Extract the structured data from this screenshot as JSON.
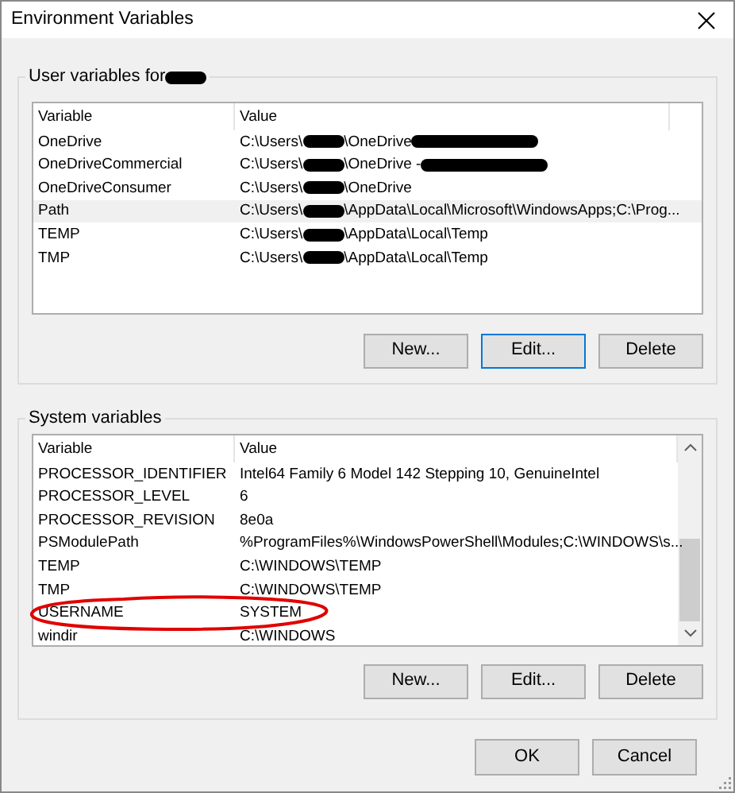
{
  "window": {
    "title": "Environment Variables"
  },
  "user_variables": {
    "label": "User variables for",
    "label_redacted": true,
    "columns": [
      "Variable",
      "Value"
    ],
    "rows": [
      {
        "name": "OneDrive",
        "selected": false,
        "value": [
          {
            "kind": "text",
            "text": "C:\\Users\\"
          },
          {
            "kind": "redaction"
          },
          {
            "kind": "text",
            "text": "\\OneDrive"
          },
          {
            "kind": "redaction"
          }
        ]
      },
      {
        "name": "OneDriveCommercial",
        "selected": false,
        "value": [
          {
            "kind": "text",
            "text": "C:\\Users\\"
          },
          {
            "kind": "redaction"
          },
          {
            "kind": "text",
            "text": "\\OneDrive -"
          },
          {
            "kind": "redaction"
          }
        ]
      },
      {
        "name": "OneDriveConsumer",
        "selected": false,
        "value": [
          {
            "kind": "text",
            "text": "C:\\Users\\"
          },
          {
            "kind": "redaction"
          },
          {
            "kind": "text",
            "text": "\\OneDrive"
          }
        ]
      },
      {
        "name": "Path",
        "selected": true,
        "value": [
          {
            "kind": "text",
            "text": "C:\\Users\\"
          },
          {
            "kind": "redaction"
          },
          {
            "kind": "text",
            "text": "\\AppData\\Local\\Microsoft\\WindowsApps;C:\\Prog..."
          }
        ]
      },
      {
        "name": "TEMP",
        "selected": false,
        "value": [
          {
            "kind": "text",
            "text": "C:\\Users\\"
          },
          {
            "kind": "redaction"
          },
          {
            "kind": "text",
            "text": "\\AppData\\Local\\Temp"
          }
        ]
      },
      {
        "name": "TMP",
        "selected": false,
        "value": [
          {
            "kind": "text",
            "text": "C:\\Users\\"
          },
          {
            "kind": "redaction"
          },
          {
            "kind": "text",
            "text": "\\AppData\\Local\\Temp"
          }
        ]
      }
    ],
    "buttons": [
      {
        "label": "New...",
        "default": false
      },
      {
        "label": "Edit...",
        "default": true
      },
      {
        "label": "Delete",
        "default": false
      }
    ]
  },
  "system_variables": {
    "label": "System variables",
    "columns": [
      "Variable",
      "Value"
    ],
    "rows": [
      {
        "name": "PROCESSOR_IDENTIFIER",
        "selected": false,
        "value": [
          {
            "kind": "text",
            "text": "Intel64 Family 6 Model 142 Stepping 10, GenuineIntel"
          }
        ]
      },
      {
        "name": "PROCESSOR_LEVEL",
        "selected": false,
        "value": [
          {
            "kind": "text",
            "text": "6"
          }
        ]
      },
      {
        "name": "PROCESSOR_REVISION",
        "selected": false,
        "value": [
          {
            "kind": "text",
            "text": "8e0a"
          }
        ]
      },
      {
        "name": "PSModulePath",
        "selected": false,
        "value": [
          {
            "kind": "text",
            "text": "%ProgramFiles%\\WindowsPowerShell\\Modules;C:\\WINDOWS\\s..."
          }
        ]
      },
      {
        "name": "TEMP",
        "selected": false,
        "value": [
          {
            "kind": "text",
            "text": "C:\\WINDOWS\\TEMP"
          }
        ]
      },
      {
        "name": "TMP",
        "selected": false,
        "value": [
          {
            "kind": "text",
            "text": "C:\\WINDOWS\\TEMP"
          }
        ]
      },
      {
        "name": "USERNAME",
        "selected": false,
        "annotated": true,
        "value": [
          {
            "kind": "text",
            "text": "SYSTEM"
          }
        ]
      },
      {
        "name": "windir",
        "selected": false,
        "value": [
          {
            "kind": "text",
            "text": "C:\\WINDOWS"
          }
        ]
      }
    ],
    "buttons": [
      {
        "label": "New...",
        "default": false
      },
      {
        "label": "Edit...",
        "default": false
      },
      {
        "label": "Delete",
        "default": false
      }
    ]
  },
  "footer_buttons": [
    {
      "label": "OK",
      "default": false
    },
    {
      "label": "Cancel",
      "default": false
    }
  ]
}
